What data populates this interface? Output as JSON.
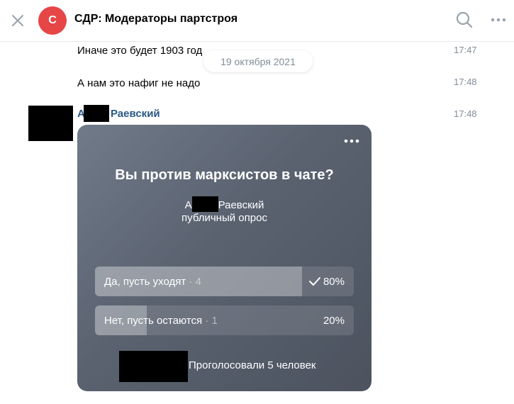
{
  "header": {
    "avatar_letter": "С",
    "title": "СДР: Модераторы партстроя"
  },
  "date_separator": "19 октября 2021",
  "messages": [
    {
      "text": "Иначе это будет 1903 год",
      "time": "17:47"
    },
    {
      "text": "А нам это нафиг не надо",
      "time": "17:48"
    }
  ],
  "poll_message": {
    "author_first_initial": "А",
    "author_last": "Раевский",
    "time": "17:48"
  },
  "poll": {
    "question": "Вы против марксистов в чате?",
    "author_initial": "А",
    "author_last": "Раевский",
    "type": "публичный опрос",
    "options": [
      {
        "label": "Да, пусть уходят",
        "count": "4",
        "percent": "80%",
        "fill": 0.8,
        "selected": true
      },
      {
        "label": "Нет, пусть остаются",
        "count": "1",
        "percent": "20%",
        "fill": 0.2,
        "selected": false
      }
    ],
    "footer": "Проголосовали 5 человек"
  },
  "colors": {
    "avatar": "#e64646",
    "author_link": "#2a5885",
    "meta_gray": "#818c99"
  }
}
